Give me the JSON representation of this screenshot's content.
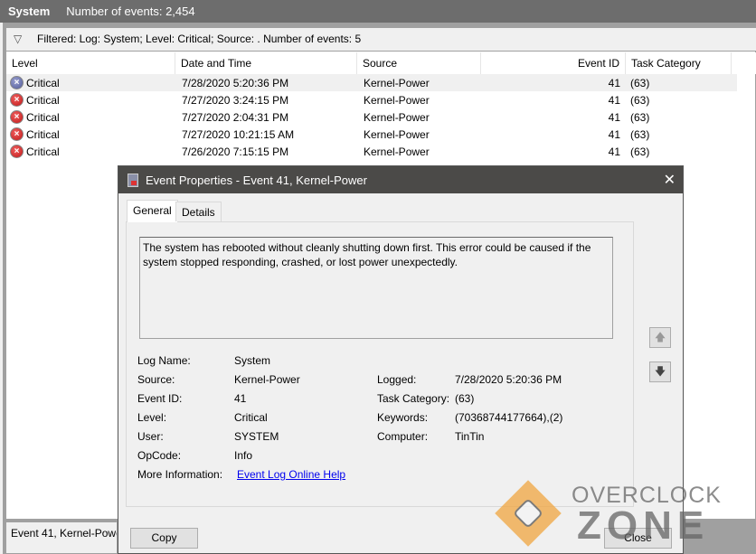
{
  "header": {
    "log_name": "System",
    "event_count": "Number of events: 2,454"
  },
  "filter": {
    "icon": "filter-icon",
    "text": "Filtered: Log: System; Level: Critical; Source: . Number of events: 5"
  },
  "columns": [
    "Level",
    "Date and Time",
    "Source",
    "Event ID",
    "Task Category"
  ],
  "events": [
    {
      "level": "Critical",
      "datetime": "7/28/2020 5:20:36 PM",
      "source": "Kernel-Power",
      "event_id": "41",
      "task_category": "(63)"
    },
    {
      "level": "Critical",
      "datetime": "7/27/2020 3:24:15 PM",
      "source": "Kernel-Power",
      "event_id": "41",
      "task_category": "(63)"
    },
    {
      "level": "Critical",
      "datetime": "7/27/2020 2:04:31 PM",
      "source": "Kernel-Power",
      "event_id": "41",
      "task_category": "(63)"
    },
    {
      "level": "Critical",
      "datetime": "7/27/2020 10:21:15 AM",
      "source": "Kernel-Power",
      "event_id": "41",
      "task_category": "(63)"
    },
    {
      "level": "Critical",
      "datetime": "7/26/2020 7:15:15 PM",
      "source": "Kernel-Power",
      "event_id": "41",
      "task_category": "(63)"
    }
  ],
  "bottom_pane": {
    "title": "Event 41, Kernel-Powe"
  },
  "dialog": {
    "title": "Event Properties - Event 41, Kernel-Power",
    "close_glyph": "✕",
    "tabs": [
      "General",
      "Details"
    ],
    "description": "The system has rebooted without cleanly shutting down first. This error could be caused if the system stopped responding, crashed, or lost power unexpectedly.",
    "fields_left": [
      {
        "label": "Log Name:",
        "value": "System"
      },
      {
        "label": "Source:",
        "value": "Kernel-Power"
      },
      {
        "label": "Event ID:",
        "value": "41"
      },
      {
        "label": "Level:",
        "value": "Critical"
      },
      {
        "label": "User:",
        "value": "SYSTEM"
      },
      {
        "label": "OpCode:",
        "value": "Info"
      },
      {
        "label": "More Information:",
        "value": "Event Log Online Help"
      }
    ],
    "fields_right": [
      {
        "label": "Logged:",
        "value": "7/28/2020 5:20:36 PM"
      },
      {
        "label": "Task Category:",
        "value": "(63)"
      },
      {
        "label": "Keywords:",
        "value": "(70368744177664),(2)"
      },
      {
        "label": "Computer:",
        "value": "TinTin"
      }
    ],
    "copy_label": "Copy",
    "close_label": "Close"
  },
  "watermark": {
    "line1": "OVERCLOCK",
    "line2": "ZONE"
  },
  "colors": {
    "header_bg": "#6d6d6d",
    "dialog_title_bg": "#4b4a48",
    "link": "#0000ee",
    "logo_orange": "#f0a640"
  }
}
